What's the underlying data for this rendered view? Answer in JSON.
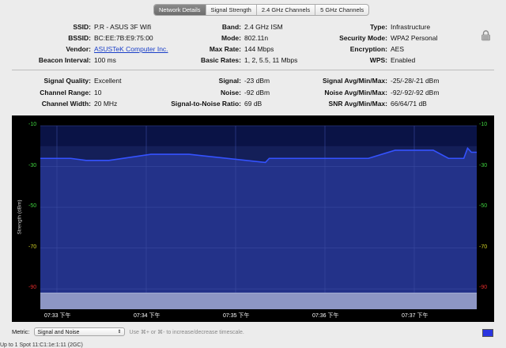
{
  "tabs": [
    {
      "label": "Network Details",
      "active": true
    },
    {
      "label": "Signal Strength",
      "active": false
    },
    {
      "label": "2.4 GHz Channels",
      "active": false
    },
    {
      "label": "5 GHz Channels",
      "active": false
    }
  ],
  "details": {
    "ssid": {
      "label": "SSID:",
      "value": "P.R - ASUS 3F Wifi"
    },
    "bssid": {
      "label": "BSSID:",
      "value": "BC:EE:7B:E9:75:00"
    },
    "vendor": {
      "label": "Vendor:",
      "value": "ASUSTeK Computer Inc."
    },
    "beacon": {
      "label": "Beacon Interval:",
      "value": "100 ms"
    },
    "band": {
      "label": "Band:",
      "value": "2.4 GHz ISM"
    },
    "mode": {
      "label": "Mode:",
      "value": "802.11n"
    },
    "max_rate": {
      "label": "Max Rate:",
      "value": "144 Mbps"
    },
    "basic_rates": {
      "label": "Basic Rates:",
      "value": "1, 2, 5.5, 11 Mbps"
    },
    "type": {
      "label": "Type:",
      "value": "Infrastructure"
    },
    "security": {
      "label": "Security Mode:",
      "value": "WPA2 Personal"
    },
    "encryption": {
      "label": "Encryption:",
      "value": "AES"
    },
    "wps": {
      "label": "WPS:",
      "value": "Enabled"
    }
  },
  "signal": {
    "quality": {
      "label": "Signal Quality:",
      "value": "Excellent"
    },
    "channel_range": {
      "label": "Channel Range:",
      "value": "10"
    },
    "channel_width": {
      "label": "Channel Width:",
      "value": "20 MHz"
    },
    "signal": {
      "label": "Signal:",
      "value": "-23 dBm"
    },
    "noise": {
      "label": "Noise:",
      "value": "-92 dBm"
    },
    "snr": {
      "label": "Signal-to-Noise Ratio:",
      "value": "69 dB"
    },
    "signal_avg": {
      "label": "Signal Avg/Min/Max:",
      "value": "-25/-28/-21 dBm"
    },
    "noise_avg": {
      "label": "Noise Avg/Min/Max:",
      "value": "-92/-92/-92 dBm"
    },
    "snr_avg": {
      "label": "SNR Avg/Min/Max:",
      "value": "66/64/71 dB"
    }
  },
  "chart_data": {
    "type": "area",
    "xlabel": "",
    "ylabel": "Strength (dBm)",
    "ylim": [
      -100,
      -10
    ],
    "yticks": [
      -10,
      -30,
      -50,
      -70,
      -90
    ],
    "ytick_labels": [
      "-10",
      "-30",
      "-50",
      "-70",
      "-90"
    ],
    "ytick_colors": [
      "#3ed23e",
      "#3ed23e",
      "#3ed23e",
      "#d8d826",
      "#e02a2a"
    ],
    "xticks": [
      "07:33 下午",
      "07:34 下午",
      "07:35 下午",
      "07:36 下午",
      "07:37 下午"
    ],
    "grid": true,
    "series": [
      {
        "name": "Signal",
        "x": [
          0,
          0.4,
          0.6,
          0.9,
          1.45,
          1.95,
          2.95,
          3.0,
          3.35,
          3.85,
          4.2,
          4.3,
          4.65,
          5.15,
          5.35,
          5.55,
          5.6,
          5.65,
          5.72
        ],
        "values": [
          -26,
          -26,
          -27,
          -27,
          -24,
          -24,
          -28,
          -26,
          -26,
          -26,
          -26,
          -26,
          -22,
          -22,
          -26,
          -26,
          -21,
          -23,
          -23
        ],
        "color": "#3452ff"
      },
      {
        "name": "Noise",
        "x": [
          0,
          5.72
        ],
        "values": [
          -92,
          -92
        ],
        "color": "#8d96c4"
      }
    ]
  },
  "metric": {
    "label": "Metric:",
    "selected": "Signal and Noise",
    "hint": "Use ⌘+ or ⌘- to increase/decrease timescale."
  },
  "status": "Up to 1 Spot  11:C1:1e:1:11 (2GC)"
}
